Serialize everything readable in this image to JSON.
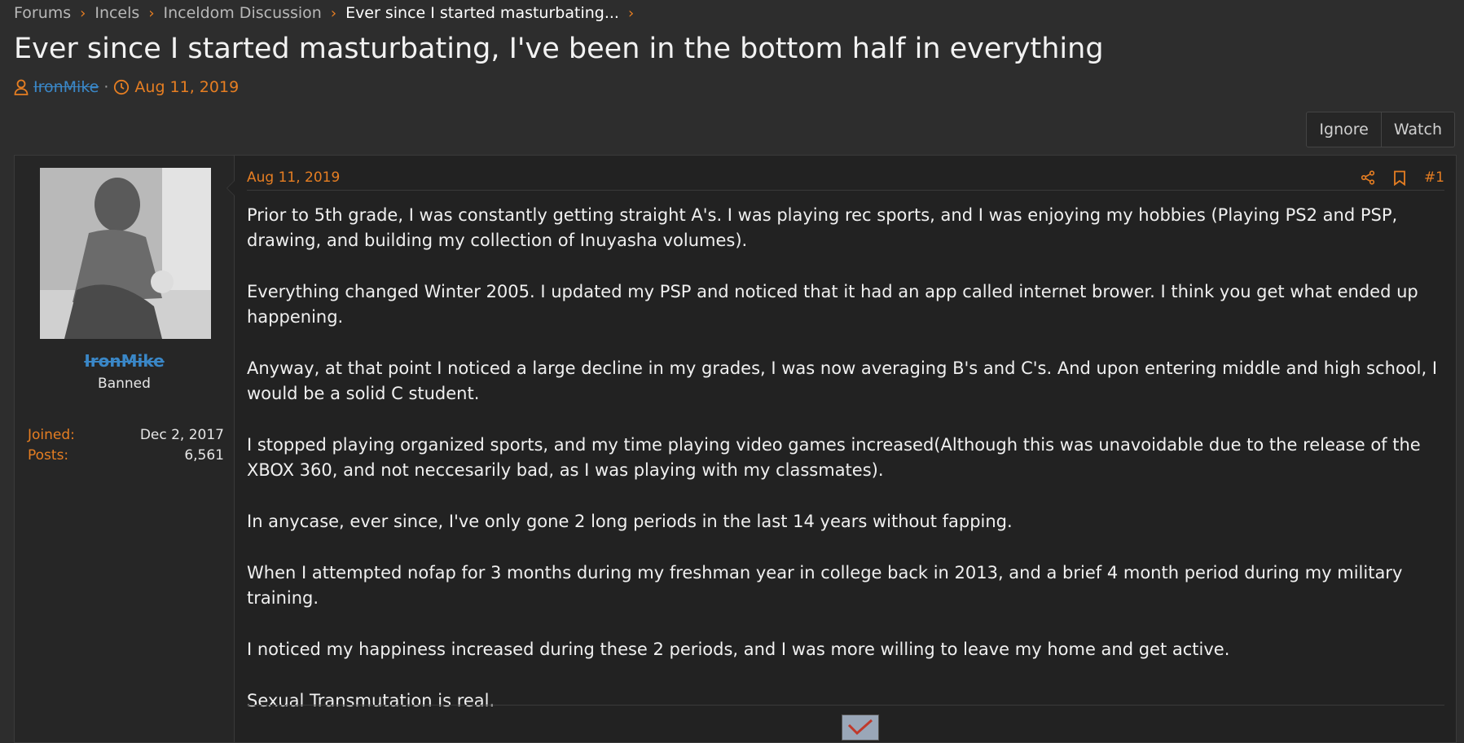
{
  "breadcrumb": {
    "items": [
      "Forums",
      "Incels",
      "Inceldom Discussion",
      "Ever since I started masturbating..."
    ]
  },
  "thread": {
    "title": "Ever since I started masturbating, I've been in the bottom half in everything",
    "author": "IronMike",
    "date": "Aug 11, 2019"
  },
  "actions": {
    "ignore": "Ignore",
    "watch": "Watch"
  },
  "user": {
    "name": "IronMike",
    "title": "Banned",
    "joined_label": "Joined:",
    "joined": "Dec 2, 2017",
    "posts_label": "Posts:",
    "posts": "6,561"
  },
  "post": {
    "date": "Aug 11, 2019",
    "number": "#1",
    "paragraphs": [
      "Prior to 5th grade, I was constantly getting straight A's. I was playing rec sports, and I was enjoying my hobbies (Playing PS2 and PSP, drawing, and building my collection of Inuyasha volumes).",
      "Everything changed Winter 2005. I updated my PSP and noticed that it had an app called internet brower. I think you get what ended up happening.",
      "Anyway, at that point I noticed a large decline in my grades, I was now averaging B's and C's. And upon entering middle and high school, I would be a solid C student.",
      "I stopped playing organized sports, and my time playing video games increased(Although this was unavoidable due to the release of the XBOX 360, and not neccesarily bad, as I was playing with my classmates).",
      "In anycase, ever since, I've only gone 2 long periods in the last 14 years without fapping.",
      "When I attempted nofap for 3 months during my freshman year in college back in 2013, and a brief 4 month period during my military training.",
      "I noticed my happiness increased during these 2 periods, and I was more willing to leave my home and get active.",
      "Sexual Transmutation is real."
    ]
  },
  "colors": {
    "accent": "#e67e22",
    "banned_user": "#3a87c7",
    "background": "#2d2d2d"
  },
  "icons": [
    "user-icon",
    "clock-icon",
    "share-icon",
    "bookmark-icon",
    "chevron-right-icon"
  ]
}
